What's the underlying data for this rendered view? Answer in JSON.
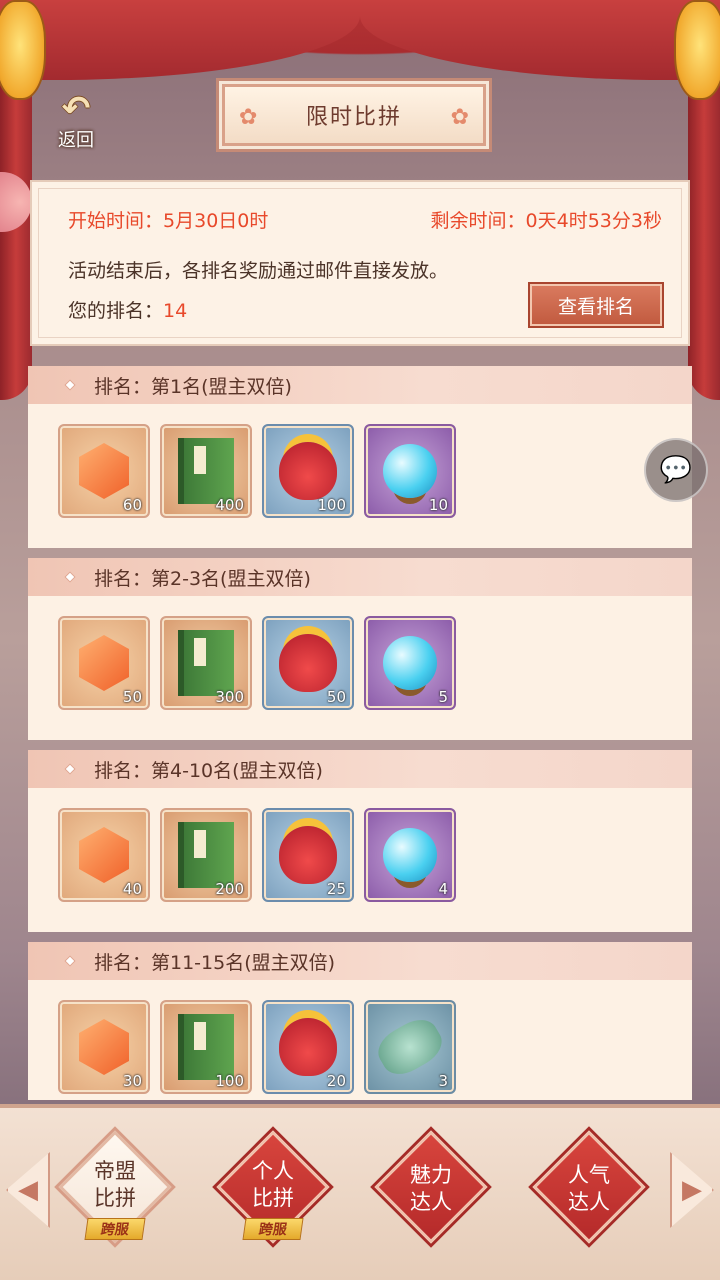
{
  "header": {
    "back_label": "返回",
    "title": "限时比拼"
  },
  "info": {
    "start_label": "开始时间：",
    "start_value": "5月30日0时",
    "remaining_label": "剩余时间：",
    "remaining_value": "0天4时53分3秒",
    "notice": "活动结束后，各排名奖励通过邮件直接发放。",
    "rank_label": "您的排名：",
    "rank_value": "14",
    "view_rank_button": "查看排名"
  },
  "sections": [
    {
      "title": "排名：第1名(盟主双倍)",
      "items": [
        {
          "icon": "orange-crystal-icon",
          "count": "60"
        },
        {
          "icon": "green-book-icon",
          "count": "400"
        },
        {
          "icon": "lucky-bag-icon",
          "count": "100"
        },
        {
          "icon": "blue-orb-icon",
          "count": "10"
        }
      ]
    },
    {
      "title": "排名：第2-3名(盟主双倍)",
      "items": [
        {
          "icon": "orange-crystal-icon",
          "count": "50"
        },
        {
          "icon": "green-book-icon",
          "count": "300"
        },
        {
          "icon": "lucky-bag-icon",
          "count": "50"
        },
        {
          "icon": "blue-orb-icon",
          "count": "5"
        }
      ]
    },
    {
      "title": "排名：第4-10名(盟主双倍)",
      "items": [
        {
          "icon": "orange-crystal-icon",
          "count": "40"
        },
        {
          "icon": "green-book-icon",
          "count": "200"
        },
        {
          "icon": "lucky-bag-icon",
          "count": "25"
        },
        {
          "icon": "blue-orb-icon",
          "count": "4"
        }
      ]
    },
    {
      "title": "排名：第11-15名(盟主双倍)",
      "items": [
        {
          "icon": "orange-crystal-icon",
          "count": "30"
        },
        {
          "icon": "green-book-icon",
          "count": "100"
        },
        {
          "icon": "lucky-bag-icon",
          "count": "20"
        },
        {
          "icon": "jade-pendant-icon",
          "count": "3"
        }
      ]
    }
  ],
  "tabs": [
    {
      "label": "帝盟比拼",
      "badge": "跨服",
      "active": true
    },
    {
      "label": "个人比拼",
      "badge": "跨服",
      "active": false
    },
    {
      "label": "魅力达人",
      "badge": "",
      "active": false
    },
    {
      "label": "人气达人",
      "badge": "",
      "active": false
    }
  ],
  "colors": {
    "accent_red": "#e8492b",
    "panel_bg": "#fdf2e6",
    "tab_red": "#c93a34"
  }
}
